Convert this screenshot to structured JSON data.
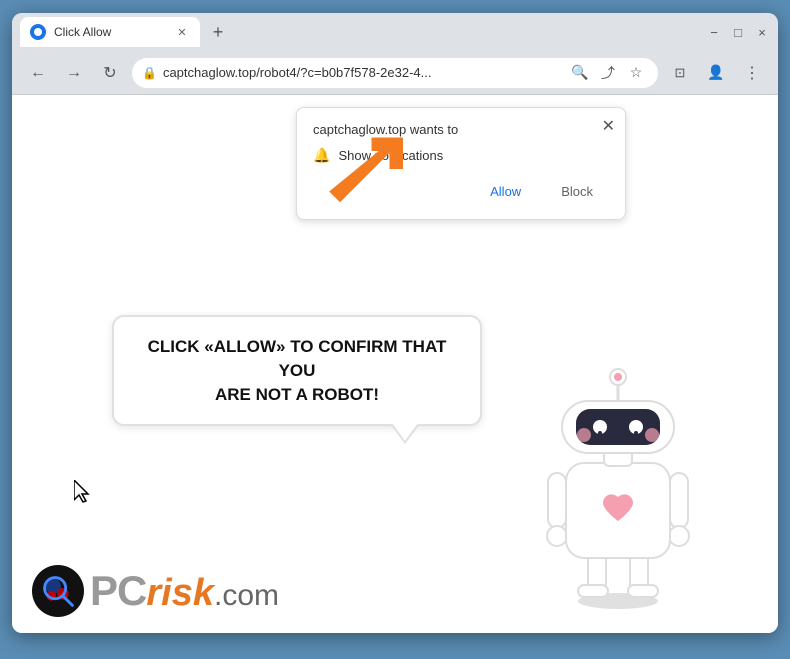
{
  "browser": {
    "tab_title": "Click Allow",
    "tab_favicon": "globe",
    "url": "captchaglow.top/robot4/?c=b0b7f578-2e32-4...",
    "window_controls": {
      "minimize": "−",
      "maximize": "□",
      "close": "×"
    },
    "nav": {
      "back": "←",
      "forward": "→",
      "refresh": "↻"
    }
  },
  "notification_popup": {
    "site": "captchaglow.top wants to",
    "notification_label": "Show notifications",
    "allow_btn": "Allow",
    "block_btn": "Block"
  },
  "speech_bubble": {
    "line1": "CLICK «ALLOW» TO CONFIRM THAT YOU",
    "line2": "ARE NOT A ROBOT!"
  },
  "logo": {
    "pc": "PC",
    "risk": "risk",
    "com": ".com"
  },
  "colors": {
    "orange_arrow": "#f47b20",
    "allow_btn": "#1a73e8",
    "bubble_border": "#e0e0e0"
  }
}
